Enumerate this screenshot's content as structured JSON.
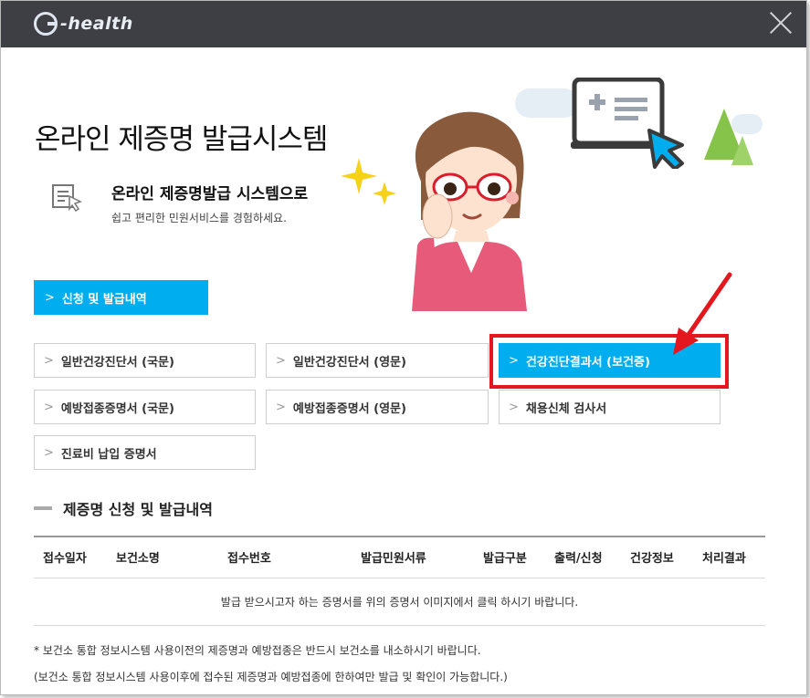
{
  "app": {
    "logo_text": "-health"
  },
  "page": {
    "title": "온라인 제증명 발급시스템",
    "intro_title": "온라인 제증명발급 시스템으로",
    "intro_sub": "쉽고 편리한 민원서비스를 경험하세요."
  },
  "primary_button": {
    "label": "신청 및 발급내역",
    "chevron": ">"
  },
  "documents": [
    {
      "label": "일반건강진단서 (국문)"
    },
    {
      "label": "일반건강진단서 (영문)"
    },
    {
      "label": "건강진단결과서 (보건증)"
    },
    {
      "label": "예방접종증명서 (국문)"
    },
    {
      "label": "예방접종증명서 (영문)"
    },
    {
      "label": "채용신체 검사서"
    },
    {
      "label": "진료비 납입 증명서"
    }
  ],
  "section": {
    "title": "제증명 신청 및 발급내역"
  },
  "table": {
    "columns": [
      "접수일자",
      "보건소명",
      "접수번호",
      "발급민원서류",
      "발급구분",
      "출력/신청",
      "건강정보",
      "처리결과"
    ],
    "empty_message": "발급 받으시고자 하는 증명서를 위의 증명서 이미지에서 클릭 하시기 바랍니다."
  },
  "notes": [
    "* 보건소 통합 정보시스템 사용이전의 제증명과 예방접종은 반드시 보건소를 내소하시기 바랍니다.",
    "(보건소 통합 정보시스템 사용이후에 접수된 제증명과 예방접종에 한하여만 발급 및 확인이 가능합니다.)"
  ],
  "colors": {
    "accent": "#00aeef",
    "titlebar": "#3d3f44",
    "highlight": "#e4161e"
  }
}
